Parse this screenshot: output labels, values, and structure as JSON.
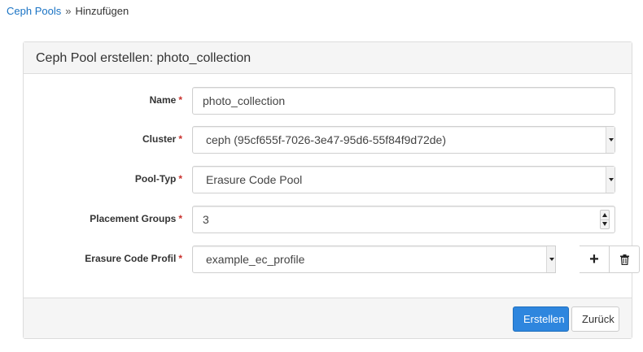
{
  "breadcrumb": {
    "parent": "Ceph Pools",
    "separator": "»",
    "current": "Hinzufügen"
  },
  "panel": {
    "title": "Ceph Pool erstellen: photo_collection"
  },
  "form": {
    "required_marker": "*",
    "name": {
      "label": "Name",
      "value": "photo_collection"
    },
    "cluster": {
      "label": "Cluster",
      "value": "ceph (95cf655f-7026-3e47-95d6-55f84f9d72de)"
    },
    "pool_type": {
      "label": "Pool-Typ",
      "value": "Erasure Code Pool"
    },
    "placement_groups": {
      "label": "Placement Groups",
      "value": "3"
    },
    "erasure_code_profile": {
      "label": "Erasure Code Profil",
      "value": "example_ec_profile"
    }
  },
  "footer": {
    "create_label": "Erstellen",
    "back_label": "Zurück"
  },
  "icons": {
    "add": "plus-icon",
    "delete": "trash-icon"
  },
  "colors": {
    "link": "#1a73c4",
    "primary": "#2e86de",
    "required": "#c9302c"
  }
}
